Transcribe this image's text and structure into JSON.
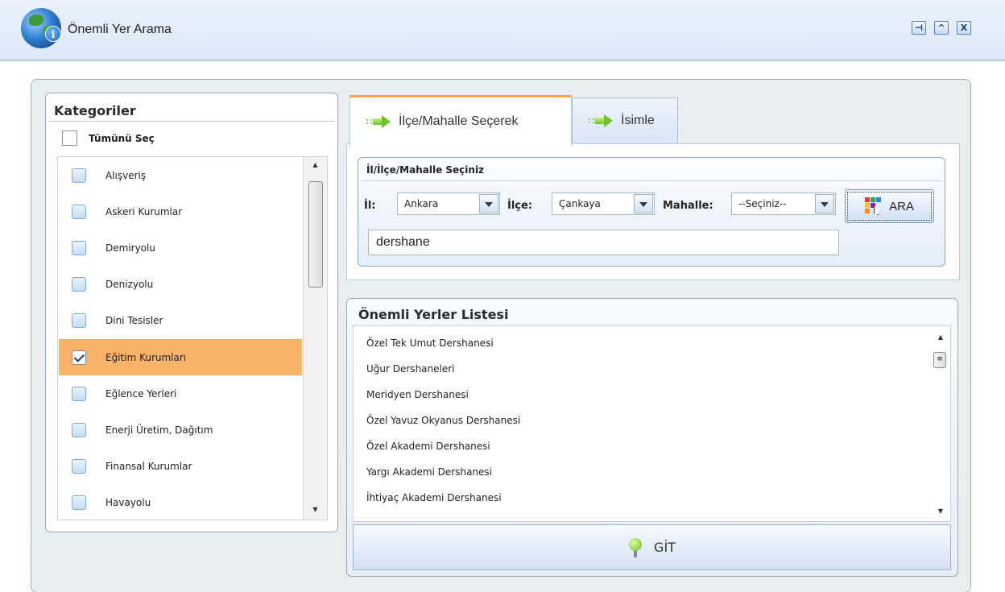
{
  "window": {
    "title": "Önemli Yer Arama",
    "controls": {
      "pin": "⊣",
      "collapse": "^",
      "close": "X"
    }
  },
  "categories": {
    "title": "Kategoriler",
    "select_all_label": "Tümünü Seç",
    "items": [
      {
        "label": "Alışveriş",
        "checked": false
      },
      {
        "label": "Askeri Kurumlar",
        "checked": false
      },
      {
        "label": "Demiryolu",
        "checked": false
      },
      {
        "label": "Denizyolu",
        "checked": false
      },
      {
        "label": "Dini Tesisler",
        "checked": false
      },
      {
        "label": "Eğitim Kurumları",
        "checked": true
      },
      {
        "label": "Eğlence Yerleri",
        "checked": false
      },
      {
        "label": "Enerji Üretim, Dağıtım",
        "checked": false
      },
      {
        "label": "Finansal Kurumlar",
        "checked": false
      },
      {
        "label": "Havayolu",
        "checked": false
      }
    ]
  },
  "tabs": [
    {
      "label": "İlçe/Mahalle Seçerek",
      "active": true
    },
    {
      "label": "İsimle",
      "active": false
    }
  ],
  "location": {
    "group_title": "İl/İlçe/Mahalle Seçiniz",
    "il_label": "İl:",
    "il_value": "Ankara",
    "ilce_label": "İlçe:",
    "ilce_value": "Çankaya",
    "mahalle_label": "Mahalle:",
    "mahalle_value": "--Seçiniz--",
    "search_button": "ARA",
    "search_text": "dershane"
  },
  "places": {
    "title": "Önemli Yerler Listesi",
    "items": [
      "Özel Tek Umut Dershanesi",
      "Uğur Dershaneleri",
      "Meridyen Dershanesi",
      "Özel Yavuz Okyanus Dershanesi",
      "Özel Akademi Dershanesi",
      "Yargı Akademi Dershanesi",
      "İhtiyaç Akademi Dershanesi"
    ],
    "go_button": "GİT"
  },
  "colors": {
    "selected_row": "#f8b26a",
    "active_tab_accent": "#f5a34b",
    "titlebar": "#dde8f7"
  }
}
